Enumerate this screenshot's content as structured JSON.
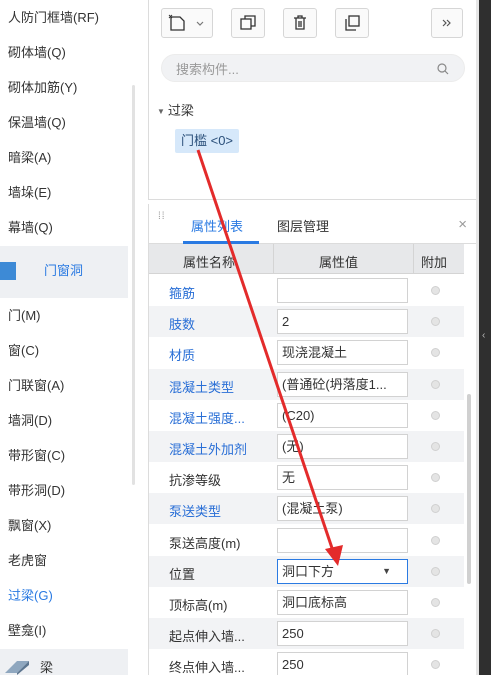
{
  "sidebar": {
    "items": [
      {
        "label": "人防门框墙(RF)"
      },
      {
        "label": "砌体墙(Q)"
      },
      {
        "label": "砌体加筋(Y)"
      },
      {
        "label": "保温墙(Q)"
      },
      {
        "label": "暗梁(A)"
      },
      {
        "label": "墙垛(E)"
      },
      {
        "label": "幕墙(Q)"
      }
    ],
    "group_label": "门窗洞",
    "group_items": [
      {
        "label": "门(M)"
      },
      {
        "label": "窗(C)"
      },
      {
        "label": "门联窗(A)"
      },
      {
        "label": "墙洞(D)"
      },
      {
        "label": "带形窗(C)"
      },
      {
        "label": "带形洞(D)"
      },
      {
        "label": "飘窗(X)"
      },
      {
        "label": "老虎窗"
      },
      {
        "label": "过梁(G)",
        "active": true
      },
      {
        "label": "壁龛(I)"
      }
    ],
    "bottom_group_label": "梁"
  },
  "tree": {
    "search_placeholder": "搜索构件...",
    "root_label": "过梁",
    "leaf_label": "门槛 <0>"
  },
  "properties": {
    "tabs": {
      "active": "属性列表",
      "inactive": "图层管理"
    },
    "close_glyph": "×",
    "headers": {
      "name": "属性名称",
      "value": "属性值",
      "extra": "附加"
    },
    "rows": [
      {
        "name": "箍筋",
        "value": "",
        "blue": true
      },
      {
        "name": "肢数",
        "value": "2",
        "blue": true
      },
      {
        "name": "材质",
        "value": "现浇混凝土",
        "blue": true
      },
      {
        "name": "混凝土类型",
        "value": "(普通砼(坍落度1...",
        "blue": true
      },
      {
        "name": "混凝土强度...",
        "value": "(C20)",
        "blue": true
      },
      {
        "name": "混凝土外加剂",
        "value": "(无)",
        "blue": true
      },
      {
        "name": "抗渗等级",
        "value": "无",
        "blue": false
      },
      {
        "name": "泵送类型",
        "value": "(混凝土泵)",
        "blue": true
      },
      {
        "name": "泵送高度(m)",
        "value": "",
        "blue": false
      },
      {
        "name": "位置",
        "value": "洞口下方",
        "blue": false,
        "dropdown": true,
        "selected": true
      },
      {
        "name": "顶标高(m)",
        "value": "洞口底标高",
        "blue": false
      },
      {
        "name": "起点伸入墙...",
        "value": "250",
        "blue": false
      },
      {
        "name": "终点伸入墙...",
        "value": "250",
        "blue": false
      }
    ]
  },
  "colors": {
    "accent": "#2a7ae2",
    "annotation_arrow": "#e32b2b"
  }
}
